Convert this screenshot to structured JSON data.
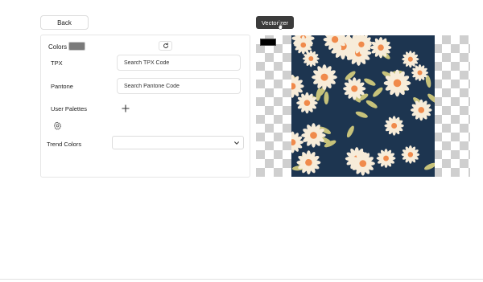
{
  "back_label": "Back",
  "colors": {
    "label": "Colors",
    "swatch_color": "#7a7a7a",
    "reset_icon": "refresh-icon"
  },
  "tpx": {
    "label": "TPX",
    "placeholder": "Search TPX Code"
  },
  "pantone": {
    "label": "Pantone",
    "placeholder": "Search Pantone Code"
  },
  "user_palettes": {
    "label": "User Palettes",
    "add_icon": "plus-icon",
    "settings_icon": "gear-icon"
  },
  "trend_colors": {
    "label": "Trend Colors",
    "selected": "",
    "icon": "chevron-down-icon"
  },
  "vectorizer_label": "Vectorizer",
  "preview": {
    "background_chip_color": "#000000",
    "pattern_background": "#1d3550",
    "flower_petal": "#f7ecd9",
    "flower_center": "#f08a4b",
    "leaf": "#c7c27a"
  }
}
